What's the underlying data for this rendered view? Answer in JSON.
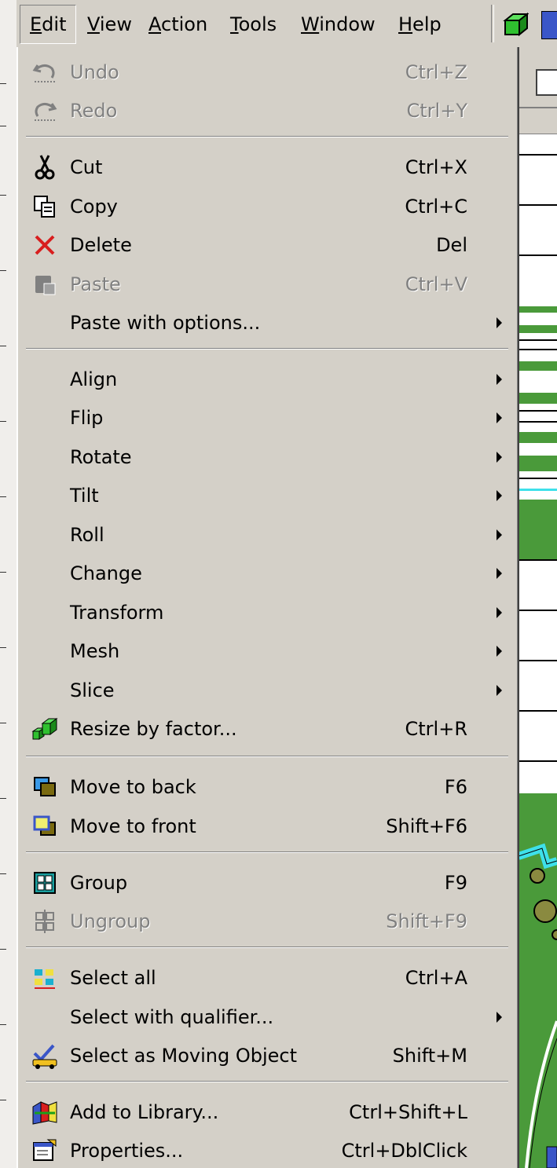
{
  "menubar": {
    "items": [
      {
        "label": "Edit"
      },
      {
        "label": "View"
      },
      {
        "label": "Action"
      },
      {
        "label": "Tools"
      },
      {
        "label": "Window"
      },
      {
        "label": "Help"
      }
    ]
  },
  "menu": {
    "undo": {
      "label": "Undo",
      "shortcut": "Ctrl+Z",
      "icon": "undo-icon",
      "enabled": false
    },
    "redo": {
      "label": "Redo",
      "shortcut": "Ctrl+Y",
      "icon": "redo-icon",
      "enabled": false
    },
    "cut": {
      "label": "Cut",
      "shortcut": "Ctrl+X",
      "icon": "scissors-icon"
    },
    "copy": {
      "label": "Copy",
      "shortcut": "Ctrl+C",
      "icon": "copy-icon"
    },
    "delete": {
      "label": "Delete",
      "shortcut": "Del",
      "icon": "delete-x-icon"
    },
    "paste": {
      "label": "Paste",
      "shortcut": "Ctrl+V",
      "icon": "paste-icon",
      "enabled": false
    },
    "paste_with_options": {
      "label": "Paste with options..."
    },
    "align": {
      "label": "Align"
    },
    "flip": {
      "label": "Flip"
    },
    "rotate": {
      "label": "Rotate"
    },
    "tilt": {
      "label": "Tilt"
    },
    "roll": {
      "label": "Roll"
    },
    "change": {
      "label": "Change"
    },
    "transform": {
      "label": "Transform"
    },
    "mesh": {
      "label": "Mesh"
    },
    "slice": {
      "label": "Slice"
    },
    "resize": {
      "label": "Resize by factor...",
      "shortcut": "Ctrl+R",
      "icon": "resize-icon"
    },
    "move_back": {
      "label": "Move to back",
      "shortcut": "F6",
      "icon": "move-to-back-icon"
    },
    "move_front": {
      "label": "Move to front",
      "shortcut": "Shift+F6",
      "icon": "move-to-front-icon"
    },
    "group": {
      "label": "Group",
      "shortcut": "F9",
      "icon": "group-icon"
    },
    "ungroup": {
      "label": "Ungroup",
      "shortcut": "Shift+F9",
      "icon": "ungroup-icon",
      "enabled": false
    },
    "select_all": {
      "label": "Select all",
      "shortcut": "Ctrl+A",
      "icon": "select-all-icon"
    },
    "select_qualifier": {
      "label": "Select with qualifier..."
    },
    "select_moving": {
      "label": "Select as Moving Object",
      "shortcut": "Shift+M",
      "icon": "moving-object-icon"
    },
    "add_library": {
      "label": "Add to Library...",
      "shortcut": "Ctrl+Shift+L",
      "icon": "library-icon"
    },
    "properties": {
      "label": "Properties...",
      "shortcut": "Ctrl+DblClick",
      "icon": "properties-icon"
    }
  }
}
